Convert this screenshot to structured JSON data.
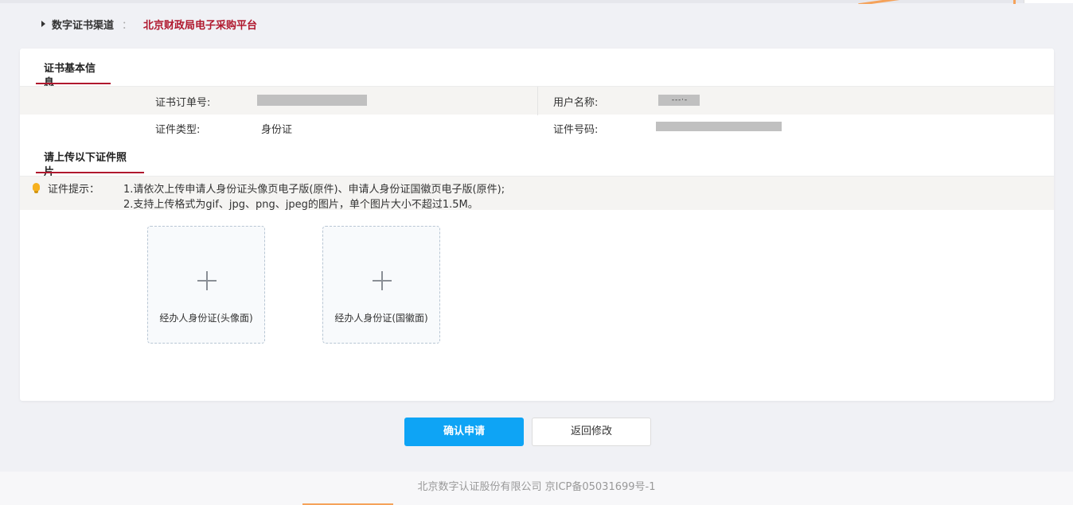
{
  "breadcrumb": {
    "label": "数字证书渠道",
    "separator": "：",
    "platform": "北京财政局电子采购平台"
  },
  "cert_info": {
    "section_title": "证书基本信息",
    "order_no_label": "证书订单号:",
    "user_name_label": "用户名称:",
    "user_name_value": "- - - · -",
    "id_type_label": "证件类型:",
    "id_type_value": "身份证",
    "id_no_label": "证件号码:"
  },
  "upload": {
    "section_title": "请上传以下证件照片",
    "hint_label": "证件提示：",
    "hint_line1": "1.请依次上传申请人身份证头像页电子版(原件)、申请人身份证国徽页电子版(原件);",
    "hint_line2": "2.支持上传格式为gif、jpg、png、jpeg的图片，单个图片大小不超过1.5M。",
    "boxes": [
      {
        "caption": "经办人身份证(头像面)"
      },
      {
        "caption": "经办人身份证(国徽面)"
      }
    ]
  },
  "actions": {
    "confirm_label": "确认申请",
    "back_label": "返回修改"
  },
  "footer": {
    "text": "北京数字认证股份有限公司 京ICP备05031699号-1"
  },
  "colors": {
    "accent_red": "#b0182e",
    "primary_blue": "#0ea4f5",
    "page_bg": "#f0f1f5"
  }
}
